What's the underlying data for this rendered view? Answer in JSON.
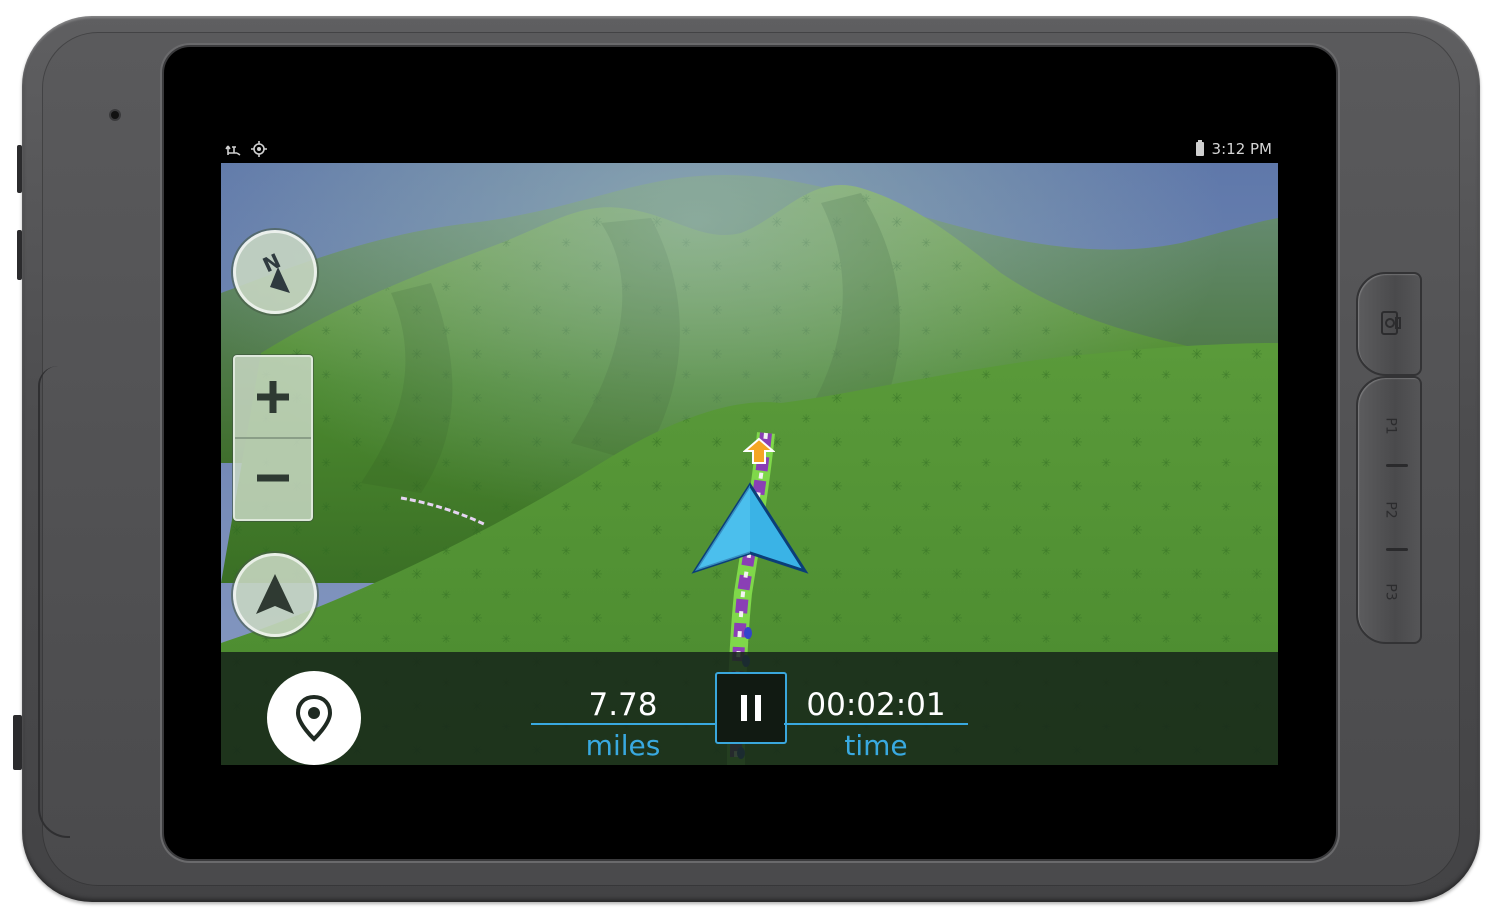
{
  "status_bar": {
    "time": "3:12 PM",
    "left_icons": [
      "usb-mode-icon",
      "gps-target-icon"
    ],
    "right_icons": [
      "battery-icon"
    ]
  },
  "map_controls": {
    "compass_letter": "N",
    "zoom_in_label": "+",
    "zoom_out_label": "−"
  },
  "stats": {
    "distance_value": "7.78",
    "distance_label": "miles",
    "time_value": "00:02:01",
    "time_label": "time"
  },
  "hardware_buttons": {
    "camera_icon": "camera-icon",
    "p1": "P1",
    "p2": "P2",
    "p3": "P3"
  },
  "colors": {
    "accent_blue": "#39a9e0",
    "bottom_bar": "#18281a",
    "terrain_green": "#4e8a34",
    "track_purple": "#8a3fb5"
  }
}
